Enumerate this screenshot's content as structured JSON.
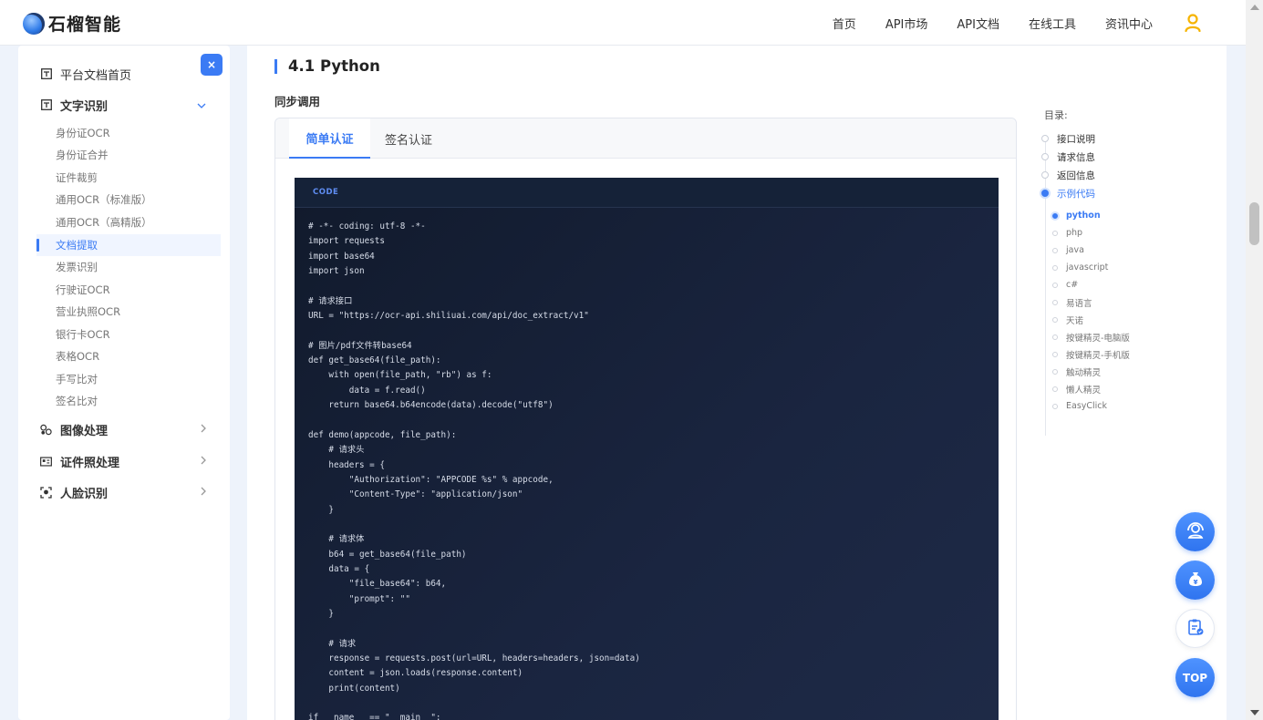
{
  "header": {
    "logo_text": "石榴智能",
    "nav": [
      "首页",
      "API市场",
      "API文档",
      "在线工具",
      "资讯中心"
    ]
  },
  "sidebar": {
    "close_label": "×",
    "home": "平台文档首页",
    "ocr_group": "文字识别",
    "ocr_items": [
      "身份证OCR",
      "身份证合并",
      "证件裁剪",
      "通用OCR（标准版）",
      "通用OCR（高精版）",
      "文档提取",
      "发票识别",
      "行驶证OCR",
      "营业执照OCR",
      "银行卡OCR",
      "表格OCR",
      "手写比对",
      "签名比对"
    ],
    "active_item": "文档提取",
    "groups": [
      "图像处理",
      "证件照处理",
      "人脸识别"
    ]
  },
  "main": {
    "title": "4.1 Python",
    "subtitle": "同步调用",
    "tabs": [
      "简单认证",
      "签名认证"
    ],
    "code_label": "CODE",
    "code": "# -*- coding: utf-8 -*-\nimport requests\nimport base64\nimport json\n\n# 请求接口\nURL = \"https://ocr-api.shiliuai.com/api/doc_extract/v1\"\n\n# 图片/pdf文件转base64\ndef get_base64(file_path):\n    with open(file_path, \"rb\") as f:\n        data = f.read()\n    return base64.b64encode(data).decode(\"utf8\")\n\ndef demo(appcode, file_path):\n    # 请求头\n    headers = {\n        \"Authorization\": \"APPCODE %s\" % appcode,\n        \"Content-Type\": \"application/json\"\n    }\n\n    # 请求体\n    b64 = get_base64(file_path)\n    data = {\n        \"file_base64\": b64,\n        \"prompt\": \"\"\n    }\n\n    # 请求\n    response = requests.post(url=URL, headers=headers, json=data)\n    content = json.loads(response.content)\n    print(content)\n\nif __name__ == \"__main__\":"
  },
  "toc": {
    "title": "目录:",
    "items": [
      "接口说明",
      "请求信息",
      "返回信息",
      "示例代码"
    ],
    "active_item": "示例代码",
    "sub_items": [
      "python",
      "php",
      "java",
      "javascript",
      "c#",
      "易语言",
      "天诺",
      "按键精灵-电脑版",
      "按键精灵-手机版",
      "触动精灵",
      "懒人精灵",
      "EasyClick"
    ],
    "active_sub": "python"
  },
  "fabs": {
    "top_label": "TOP"
  },
  "colors": {
    "accent": "#3b7bf4",
    "code_bg": "#1a2540"
  }
}
